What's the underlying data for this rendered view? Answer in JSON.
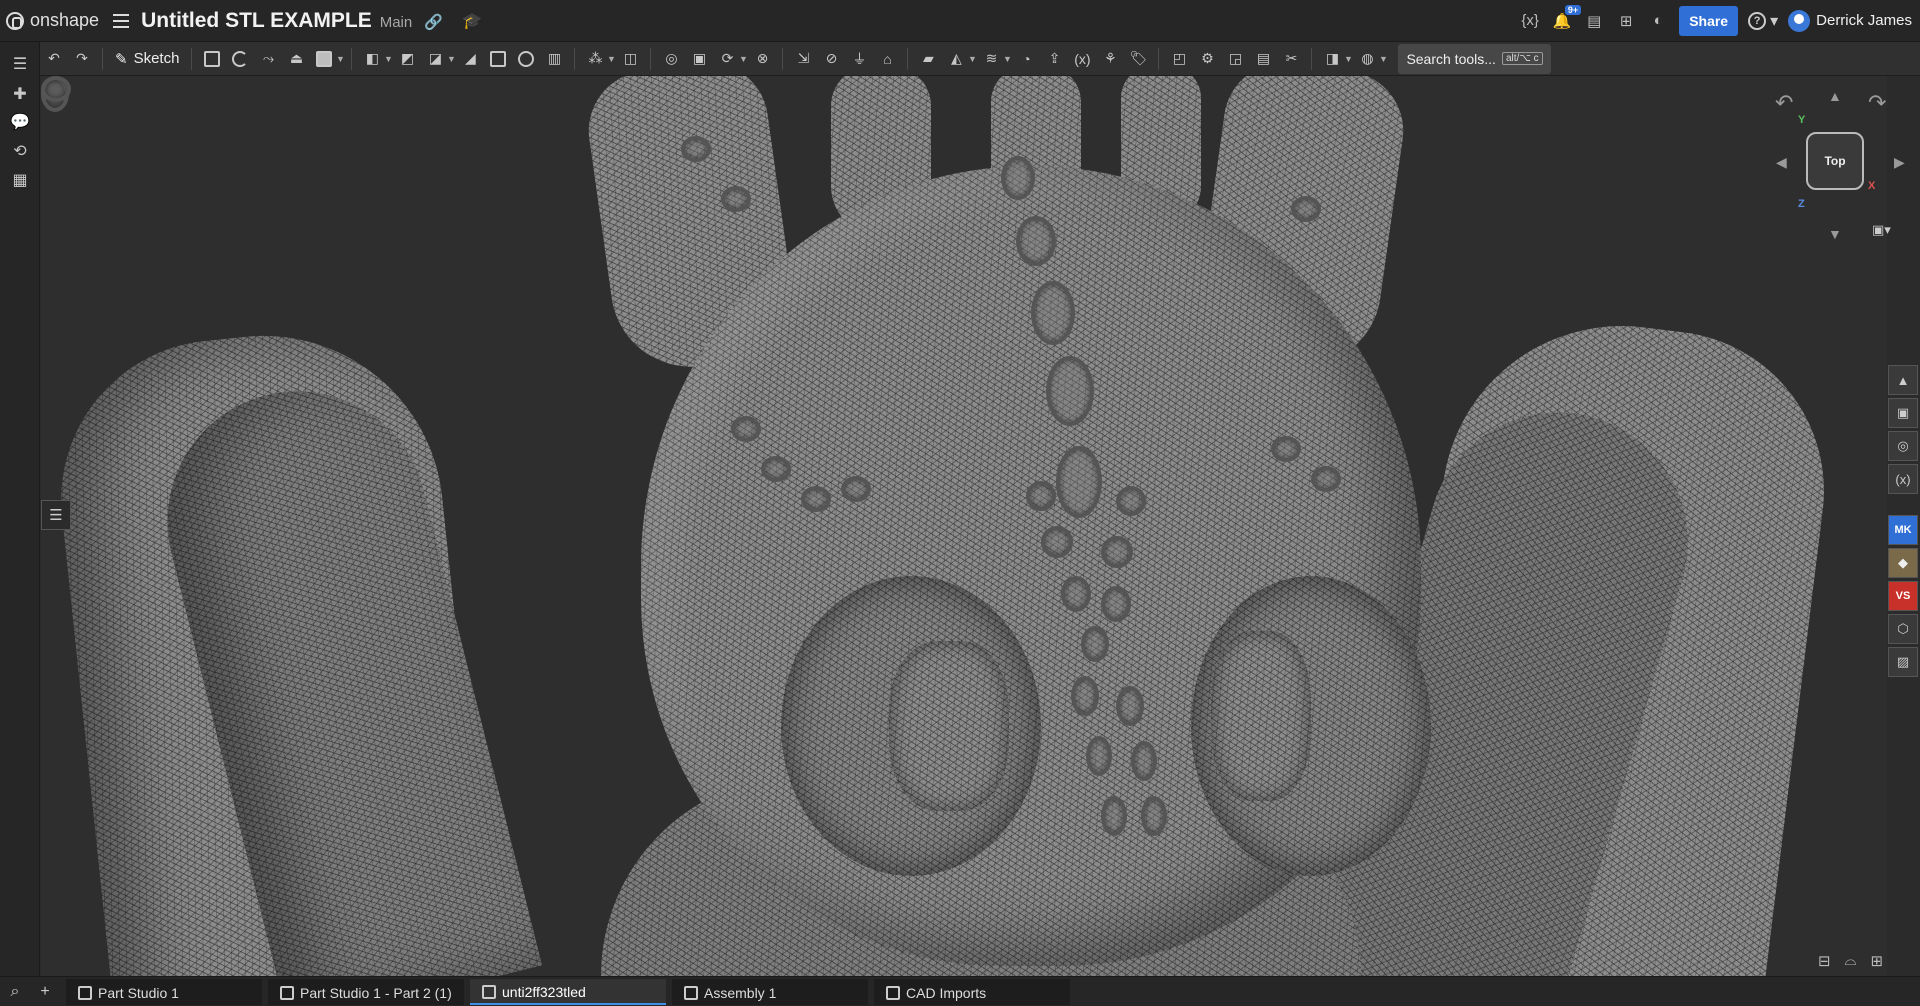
{
  "app": {
    "brand": "onshape",
    "document_title": "Untitled STL EXAMPLE",
    "branch": "Main"
  },
  "topbar": {
    "notification_badge": "9+",
    "share_label": "Share",
    "user_name": "Derrick James"
  },
  "toolbar": {
    "sketch_label": "Sketch",
    "search_label": "Search tools...",
    "search_shortcut": "alt/⌥ c"
  },
  "viewcube": {
    "face_label": "Top",
    "axis_y": "Y",
    "axis_x": "X",
    "axis_z": "Z"
  },
  "tabs": [
    {
      "label": "Part Studio 1",
      "active": false
    },
    {
      "label": "Part Studio 1 - Part 2 (1)",
      "active": false
    },
    {
      "label": "unti2ff323tled",
      "active": true
    },
    {
      "label": "Assembly 1",
      "active": false
    },
    {
      "label": "CAD Imports",
      "active": false
    }
  ],
  "right_rail": {
    "mk_label": "MK",
    "vs_label": "VS"
  },
  "colors": {
    "accent": "#2f6fd6",
    "background": "#2b2b2b"
  }
}
